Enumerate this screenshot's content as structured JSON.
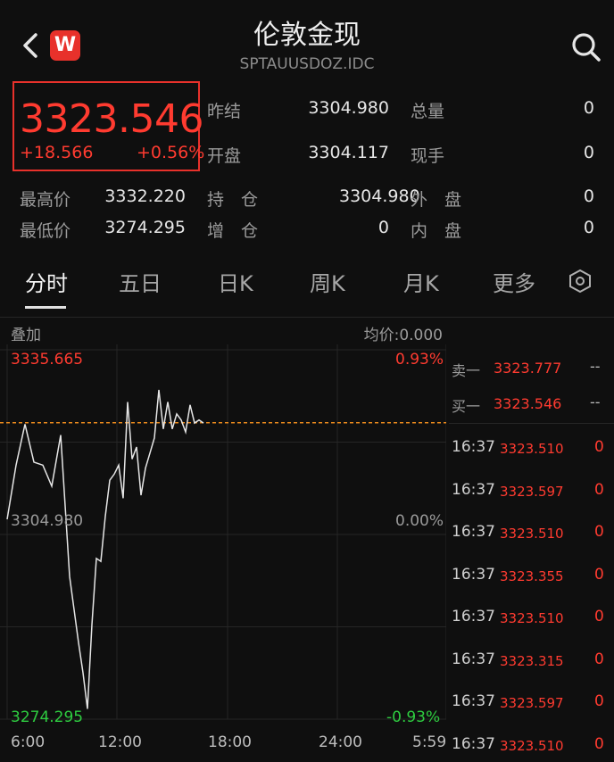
{
  "header": {
    "title": "伦敦金现",
    "subtitle": "SPTAUUSDOZ.IDC",
    "logo_letter": "W"
  },
  "quote": {
    "price": "3323.546",
    "change": "+18.566",
    "change_pct": "+0.56%",
    "stats": [
      {
        "label": "昨结",
        "value": "3304.980"
      },
      {
        "label": "开盘",
        "value": "3304.117"
      },
      {
        "label": "总量",
        "value": "0"
      },
      {
        "label": "现手",
        "value": "0"
      },
      {
        "label": "最高价",
        "value": "3332.220"
      },
      {
        "label": "最低价",
        "value": "3274.295"
      },
      {
        "label": "持　仓",
        "value": "0"
      },
      {
        "label": "增　仓",
        "value": "0"
      },
      {
        "label": "外　盘",
        "value": "0"
      },
      {
        "label": "内　盘",
        "value": "0"
      }
    ]
  },
  "tabs": [
    "分时",
    "五日",
    "日K",
    "周K",
    "月K",
    "更多"
  ],
  "chart_toolbar": {
    "overlay_label": "叠加",
    "avg_label": "均价:0.000"
  },
  "chart_data": {
    "type": "line",
    "y_top_label": "3335.665",
    "y_mid_label": "3304.980",
    "y_bottom_label": "3274.295",
    "pct_top": "0.93%",
    "pct_mid": "0.00%",
    "pct_bottom": "-0.93%",
    "x_labels": [
      "6:00",
      "12:00",
      "18:00",
      "24:00",
      "5:59"
    ],
    "ylim": [
      3274.295,
      3335.665
    ],
    "reference_line": 3323.546,
    "series": [
      {
        "x": [
          0,
          10,
          20,
          30,
          40,
          50,
          60,
          70,
          80,
          85,
          90,
          95,
          100,
          105,
          110,
          115,
          120,
          125,
          130,
          135,
          140,
          145,
          150,
          155,
          160,
          165,
          170,
          175,
          180,
          185,
          190,
          195,
          200,
          205,
          210,
          215,
          220
        ],
        "values": [
          3307.5,
          3316.5,
          3323.3,
          3317.0,
          3316.5,
          3313.0,
          3321.5,
          3298.0,
          3287.0,
          3282.0,
          3276.0,
          3290.0,
          3301.0,
          3300.5,
          3308.0,
          3314.0,
          3315.0,
          3316.5,
          3311.0,
          3327.0,
          3317.5,
          3319.5,
          3311.5,
          3316.0,
          3318.5,
          3321.0,
          3329.0,
          3322.5,
          3327.0,
          3322.5,
          3325.0,
          3324.0,
          3322.0,
          3326.5,
          3323.5,
          3324.0,
          3323.5
        ]
      }
    ],
    "line_color": "#e6e6e6",
    "ref_color": "#e98a1d"
  },
  "order_book": {
    "sell": {
      "label": "卖一",
      "price": "3323.777",
      "vol": "--"
    },
    "buy": {
      "label": "买一",
      "price": "3323.546",
      "vol": "--"
    }
  },
  "ticks": [
    {
      "time": "16:37",
      "price": "3323.510",
      "vol": "0"
    },
    {
      "time": "16:37",
      "price": "3323.597",
      "vol": "0"
    },
    {
      "time": "16:37",
      "price": "3323.510",
      "vol": "0"
    },
    {
      "time": "16:37",
      "price": "3323.355",
      "vol": "0"
    },
    {
      "time": "16:37",
      "price": "3323.510",
      "vol": "0"
    },
    {
      "time": "16:37",
      "price": "3323.315",
      "vol": "0"
    },
    {
      "time": "16:37",
      "price": "3323.597",
      "vol": "0"
    },
    {
      "time": "16:37",
      "price": "3323.510",
      "vol": "0"
    }
  ],
  "colors": {
    "up": "#ff3b30",
    "down": "#2ecc40",
    "accent": "#e8312b"
  }
}
